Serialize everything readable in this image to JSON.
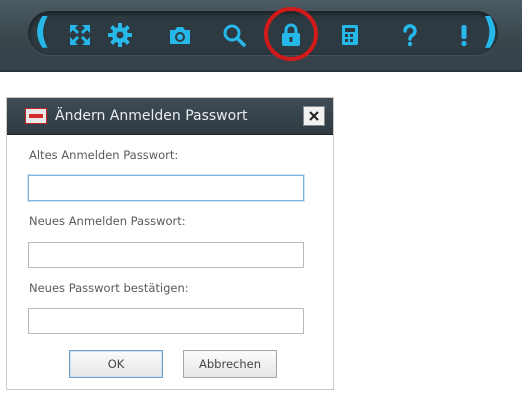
{
  "toolbar": {
    "accent_color": "#27b8ea",
    "highlight_color": "#d11a1a",
    "open_paren": "(",
    "close_paren": ")",
    "buttons": [
      {
        "icon": "expand-arrows-icon"
      },
      {
        "icon": "gear-icon"
      },
      {
        "icon": "camera-icon"
      },
      {
        "icon": "search-icon"
      },
      {
        "icon": "lock-icon",
        "highlighted": true
      },
      {
        "icon": "calculator-icon"
      },
      {
        "icon": "question-mark-icon"
      },
      {
        "icon": "exclamation-icon"
      }
    ]
  },
  "dialog": {
    "title": "Ändern Anmelden Passwort",
    "app_icon": "app-logo-icon",
    "close_icon": "close-icon",
    "fields": [
      {
        "label": "Altes Anmelden Passwort:",
        "value": "",
        "focused": true
      },
      {
        "label": "Neues Anmelden Passwort:",
        "value": ""
      },
      {
        "label": "Neues Passwort bestätigen:",
        "value": ""
      }
    ],
    "ok_label": "OK",
    "cancel_label": "Abbrechen"
  }
}
